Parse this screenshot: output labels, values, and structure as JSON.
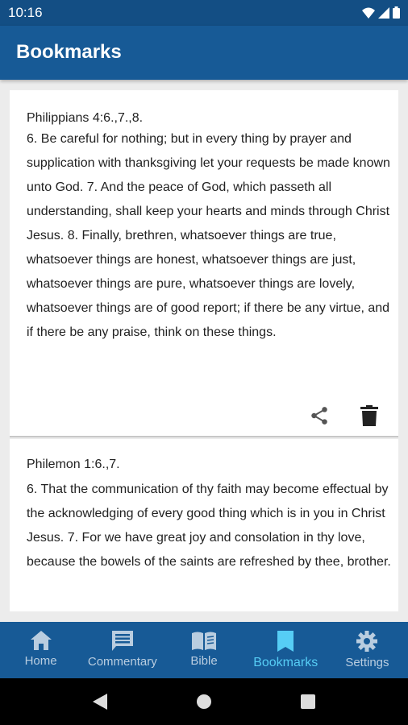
{
  "status_bar": {
    "time": "10:16",
    "icons": [
      "wifi-icon",
      "signal-icon",
      "battery-icon"
    ]
  },
  "app_bar": {
    "title": "Bookmarks"
  },
  "bookmarks": [
    {
      "reference": "Philippians 4:6.,7.,8.",
      "text": "6. Be careful for nothing; but in every thing by prayer and supplication with thanksgiving let your requests be made known unto God. 7. And the peace of God, which passeth all understanding, shall keep your hearts and minds through Christ Jesus. 8. Finally, brethren, whatsoever things are true, whatsoever things are honest, whatsoever things are just, whatsoever things are pure, whatsoever things are lovely, whatsoever things are of good report; if there be any virtue, and if there be any praise, think on these things.",
      "actions": [
        "share-icon",
        "delete-icon"
      ]
    },
    {
      "reference": "Philemon 1:6.,7.",
      "text": "6. That the communication of thy faith may become effectual by the acknowledging of every good thing which is in you in Christ Jesus. 7. For we have great joy and consolation in thy love, because the bowels of the saints are refreshed by thee, brother."
    }
  ],
  "bottom_nav": {
    "items": [
      {
        "label": "Home",
        "icon": "home-icon",
        "active": false
      },
      {
        "label": "Commentary",
        "icon": "comment-icon",
        "active": false
      },
      {
        "label": "Bible",
        "icon": "book-icon",
        "active": false
      },
      {
        "label": "Bookmarks",
        "icon": "bookmark-icon",
        "active": true
      },
      {
        "label": "Settings",
        "icon": "gear-icon",
        "active": false
      }
    ]
  },
  "colors": {
    "app_bar": "#175a96",
    "status_bar": "#134e84",
    "active_nav": "#56cdf5",
    "inactive_nav": "#b9cde0"
  },
  "system_nav": [
    "back-icon",
    "home-circle-icon",
    "recents-icon"
  ]
}
